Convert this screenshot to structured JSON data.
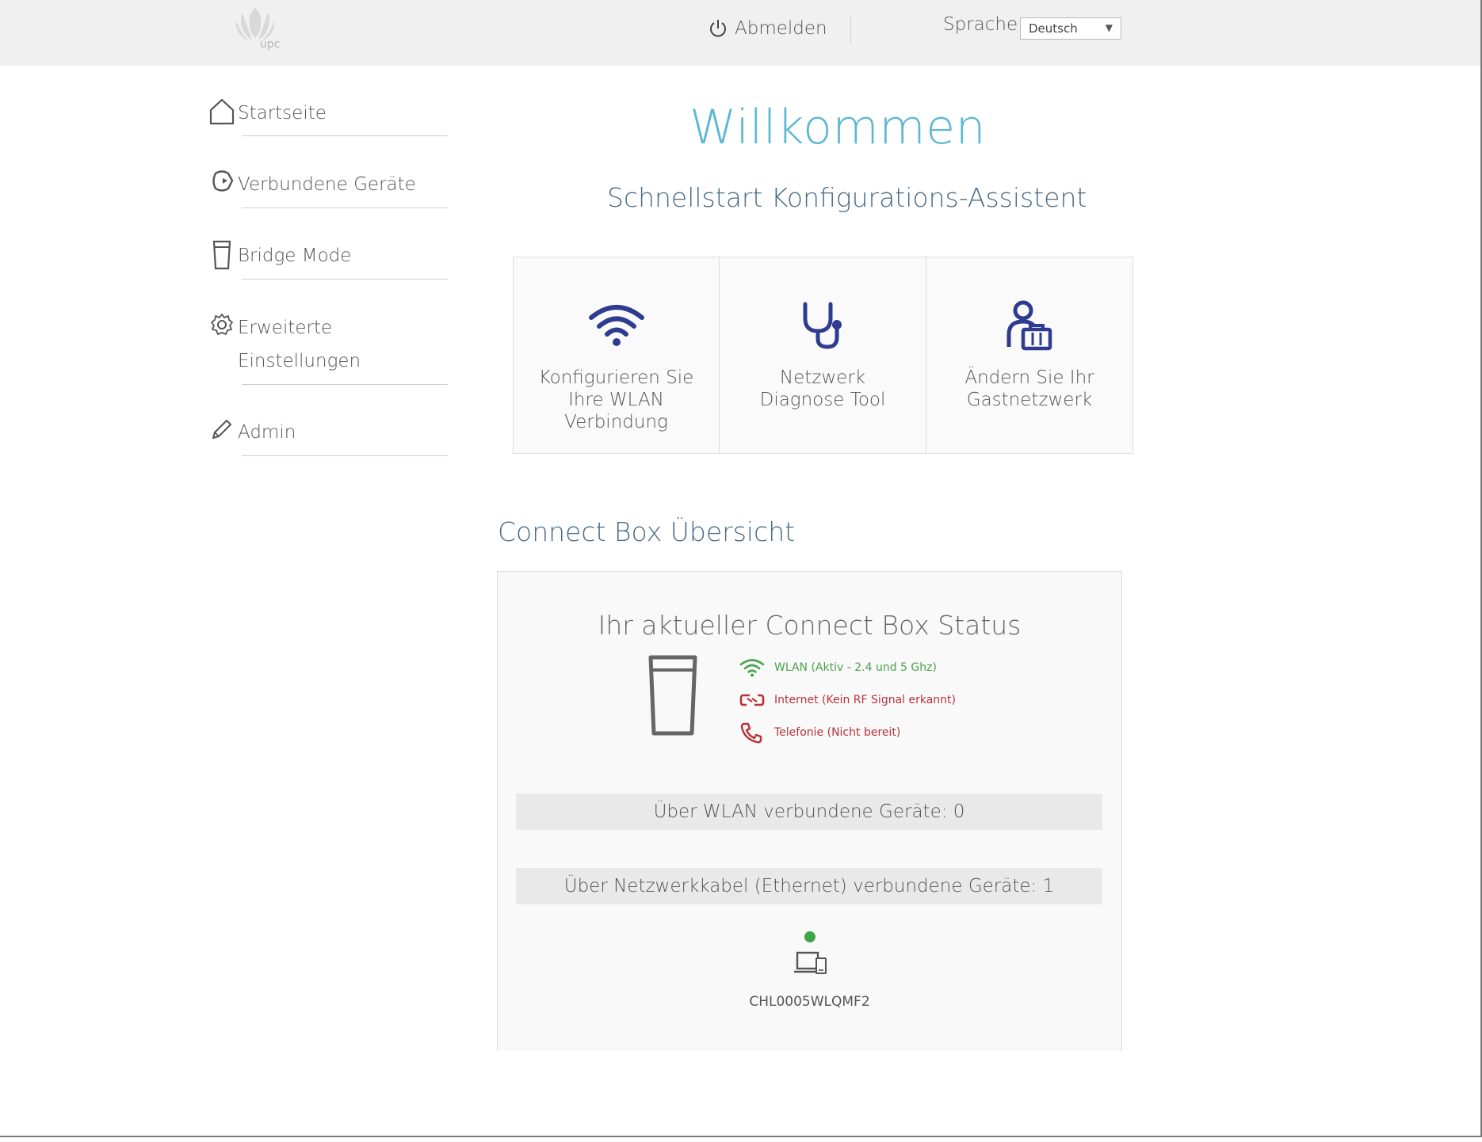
{
  "header": {
    "logo_text": "upc",
    "logout_label": "Abmelden",
    "language_label": "Sprache",
    "language_selected": "Deutsch"
  },
  "sidebar": {
    "items": [
      {
        "label": "Startseite",
        "icon": "home-icon"
      },
      {
        "label": "Verbundene Geräte",
        "icon": "devices-icon"
      },
      {
        "label": "Bridge Mode",
        "icon": "bridge-icon"
      },
      {
        "label_line1": "Erweiterte",
        "label_line2": "Einstellungen",
        "icon": "gear-icon"
      },
      {
        "label": "Admin",
        "icon": "pencil-icon"
      }
    ]
  },
  "main": {
    "welcome": "Willkommen",
    "wizard_title": "Schnellstart Konfigurations-Assistent",
    "tiles": [
      {
        "line1": "Konfigurieren Sie",
        "line2": "Ihre WLAN",
        "line3": "Verbindung",
        "icon": "wifi-icon"
      },
      {
        "line1": "Netzwerk",
        "line2": "Diagnose Tool",
        "icon": "stethoscope-icon"
      },
      {
        "line1": "Ändern Sie Ihr",
        "line2": "Gastnetzwerk",
        "icon": "guest-network-icon"
      }
    ],
    "overview_title": "Connect Box Übersicht",
    "status": {
      "title": "Ihr aktueller Connect Box Status",
      "wlan": "WLAN (Aktiv - 2.4 und 5 Ghz)",
      "internet": "Internet (Kein RF Signal erkannt)",
      "telephony": "Telefonie (Nicht bereit)"
    },
    "wlan_devices": "Über WLAN verbundene Geräte: 0",
    "ethernet_devices": "Über Netzwerkkabel (Ethernet) verbundene Geräte: 1",
    "device_name": "CHL0005WLQMF2"
  },
  "colors": {
    "accent_blue": "#2e3b8f",
    "welcome": "#5cb8d3",
    "ok_green": "#49a24c",
    "error_red": "#b8323a"
  }
}
